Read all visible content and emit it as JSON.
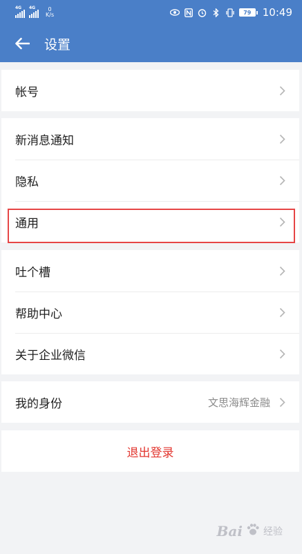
{
  "status_bar": {
    "network_1": "4G",
    "network_2": "4G",
    "speed_value": "0",
    "speed_unit": "K/s",
    "battery": "79",
    "time": "10:49",
    "icons": [
      "eye-icon",
      "nfc-icon",
      "alarm-icon",
      "bluetooth-icon",
      "vibrate-icon"
    ]
  },
  "header": {
    "title": "设置",
    "back_icon": "back-arrow-icon"
  },
  "groups": {
    "account": {
      "label": "帐号"
    },
    "notifications": {
      "label": "新消息通知"
    },
    "privacy": {
      "label": "隐私"
    },
    "general": {
      "label": "通用"
    },
    "feedback": {
      "label": "吐个槽"
    },
    "help": {
      "label": "帮助中心"
    },
    "about": {
      "label": "关于企业微信"
    },
    "identity": {
      "label": "我的身份",
      "value": "文思海辉金融"
    },
    "logout": {
      "label": "退出登录"
    }
  },
  "watermark": {
    "text": "Bai",
    "sub": "经验",
    "paw_icon": "paw-icon"
  },
  "colors": {
    "accent": "#4a7fc8",
    "logout": "#e2362f",
    "highlight_border": "#e64545",
    "background": "#f2f3f5"
  }
}
